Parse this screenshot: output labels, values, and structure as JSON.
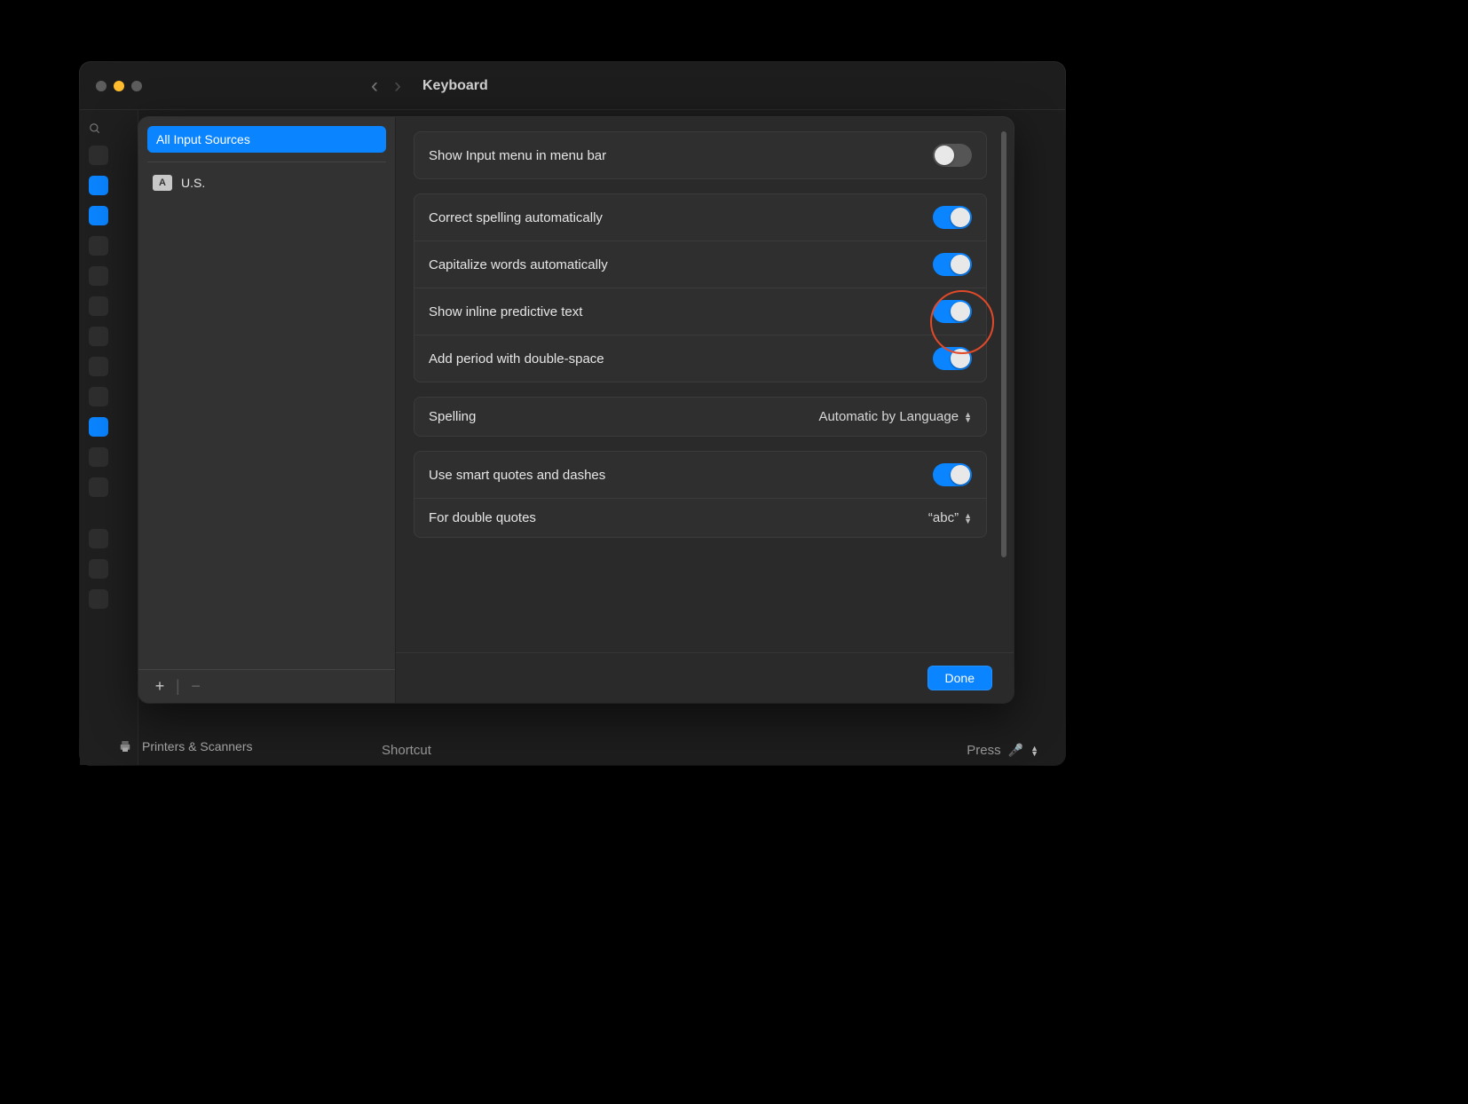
{
  "titlebar": {
    "title": "Keyboard"
  },
  "sidebar_bottom": {
    "printers": "Printers & Scanners"
  },
  "sheet": {
    "all_sources": "All Input Sources",
    "sources": [
      {
        "badge": "A",
        "name": "U.S."
      }
    ],
    "footer": {
      "plus": "+",
      "minus": "−"
    },
    "groups": {
      "menu_bar": {
        "label": "Show Input menu in menu bar",
        "on": false
      },
      "typing": [
        {
          "label": "Correct spelling automatically",
          "on": true
        },
        {
          "label": "Capitalize words automatically",
          "on": true
        },
        {
          "label": "Show inline predictive text",
          "on": true,
          "highlight": true
        },
        {
          "label": "Add period with double-space",
          "on": true
        }
      ],
      "spelling": {
        "label": "Spelling",
        "value": "Automatic by Language"
      },
      "smart": {
        "use_smart": {
          "label": "Use smart quotes and dashes",
          "on": true
        },
        "double_quotes": {
          "label": "For double quotes",
          "value": "“abc”"
        }
      }
    },
    "done": "Done"
  },
  "under": {
    "shortcut_label": "Shortcut",
    "press_label": "Press"
  }
}
